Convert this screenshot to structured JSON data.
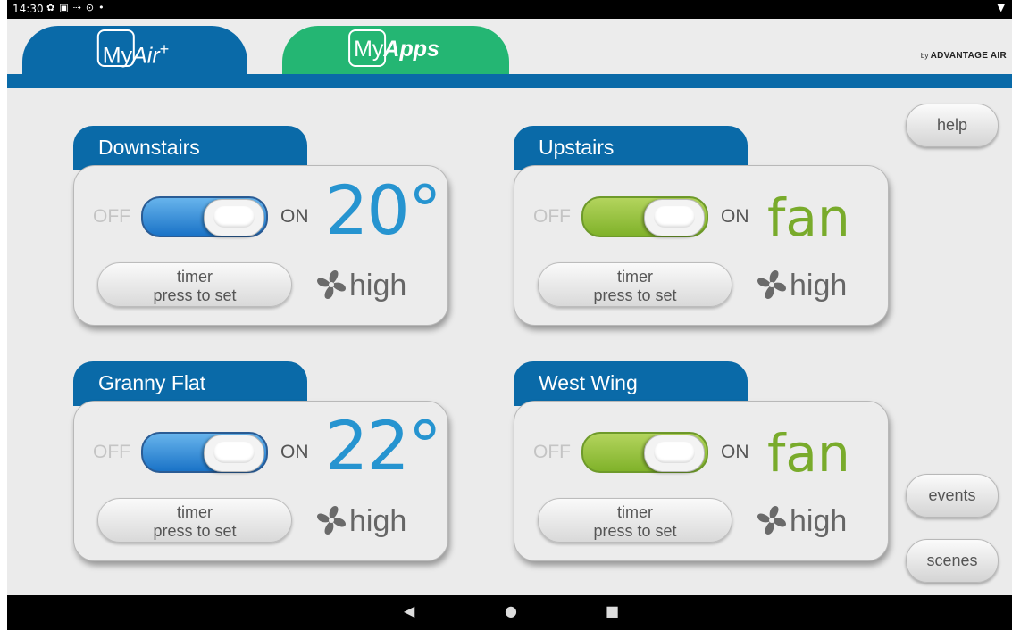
{
  "status_bar": {
    "time": "14:30",
    "icons": [
      "gear-icon",
      "image-icon",
      "signal-icon",
      "alert-icon",
      "dot-icon"
    ],
    "right_icon": "wifi-icon"
  },
  "header": {
    "tabs": [
      {
        "label_prefix": "My",
        "label_main": "Air",
        "label_suffix": "+",
        "color": "#0a6aa8",
        "active": true
      },
      {
        "label_prefix": "My",
        "label_main": "Apps",
        "label_suffix": "",
        "color": "#24b673",
        "active": false
      }
    ],
    "brand_by": "by",
    "brand_name": "ADVANTAGE AIR"
  },
  "zones": [
    {
      "name": "Downstairs",
      "off_label": "OFF",
      "on_label": "ON",
      "value": "20°",
      "mode": "temperature",
      "toggle_color": "#1a73c7",
      "timer_line1": "timer",
      "timer_line2": "press to set",
      "fan_speed": "high"
    },
    {
      "name": "Upstairs",
      "off_label": "OFF",
      "on_label": "ON",
      "value": "fan",
      "mode": "fan",
      "toggle_color": "#80b22a",
      "timer_line1": "timer",
      "timer_line2": "press to set",
      "fan_speed": "high"
    },
    {
      "name": "Granny Flat",
      "off_label": "OFF",
      "on_label": "ON",
      "value": "22°",
      "mode": "temperature",
      "toggle_color": "#1a73c7",
      "timer_line1": "timer",
      "timer_line2": "press to set",
      "fan_speed": "high"
    },
    {
      "name": "West Wing",
      "off_label": "OFF",
      "on_label": "ON",
      "value": "fan",
      "mode": "fan",
      "toggle_color": "#80b22a",
      "timer_line1": "timer",
      "timer_line2": "press to set",
      "fan_speed": "high"
    }
  ],
  "side_buttons": {
    "help": "help",
    "events": "events",
    "scenes": "scenes"
  },
  "nav_bar": {
    "back": "◀",
    "home": "●",
    "recents": "■"
  },
  "colors": {
    "primary_blue": "#0a6aa8",
    "apps_green": "#24b673",
    "temp_blue": "#2694d0",
    "fan_green": "#79ab2b"
  }
}
